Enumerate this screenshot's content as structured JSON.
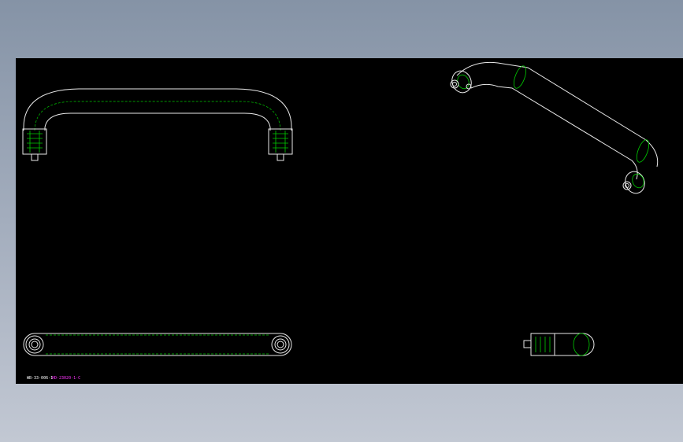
{
  "drawing": {
    "title_block_text": "WB-33-006-1",
    "part_code": "HD-23020-1-C",
    "colors": {
      "background": "#000000",
      "outline": "#e8e8e8",
      "hidden_line": "#00cc00",
      "annotation": "#ff33ff"
    }
  }
}
